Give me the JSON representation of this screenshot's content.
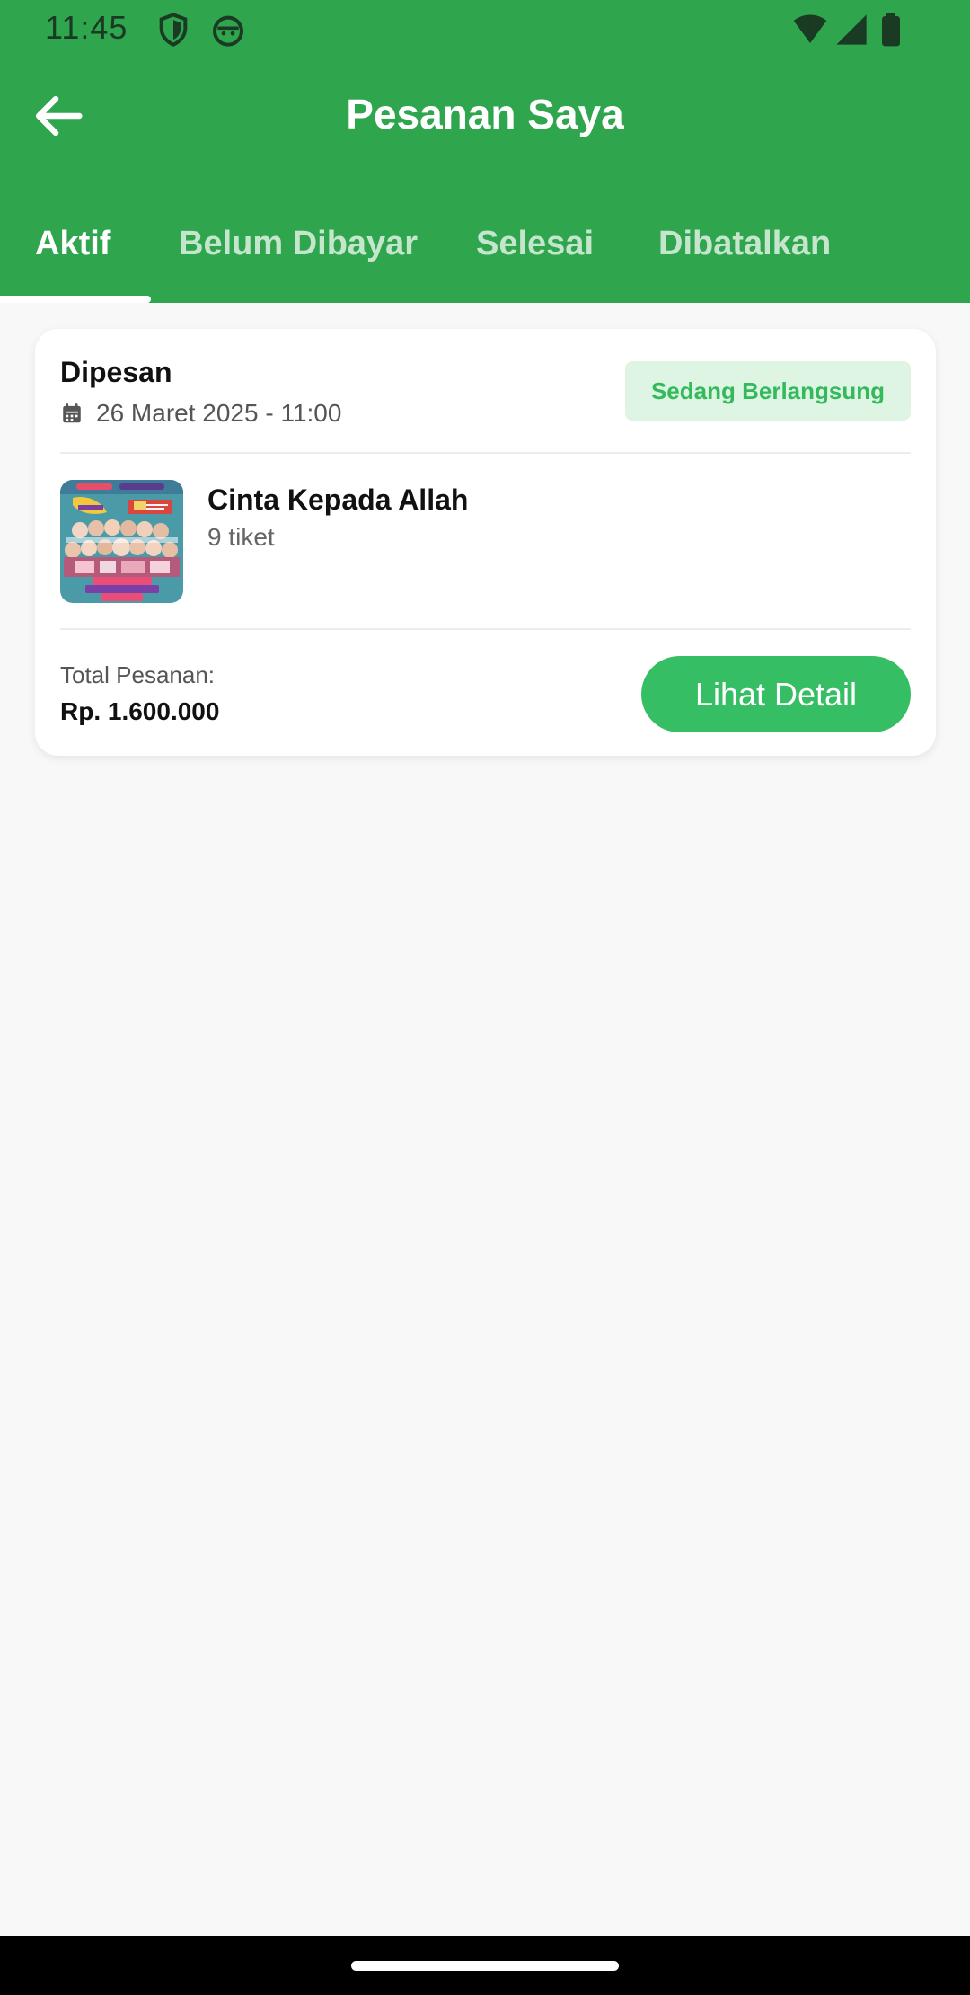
{
  "status_bar": {
    "time": "11:45",
    "icons": [
      "shield-icon",
      "android-face-icon",
      "wifi-icon",
      "cellular-signal-icon",
      "battery-icon"
    ]
  },
  "header": {
    "title": "Pesanan Saya",
    "back_icon": "arrow-left-icon",
    "background_color": "#2fa64e"
  },
  "tabs": [
    {
      "label": "Aktif",
      "active": true
    },
    {
      "label": "Belum Dibayar",
      "active": false
    },
    {
      "label": "Selesai",
      "active": false
    },
    {
      "label": "Dibatalkan",
      "active": false
    }
  ],
  "orders": [
    {
      "status_label": "Dipesan",
      "date": "26 Maret 2025 - 11:00",
      "date_icon": "calendar-icon",
      "badge": "Sedang Berlangsung",
      "event_name": "Cinta Kepada Allah",
      "tickets": "9 tiket",
      "total_label": "Total Pesanan:",
      "total_value": "Rp. 1.600.000",
      "action_label": "Lihat Detail"
    }
  ],
  "colors": {
    "accent": "#35be63",
    "badge_bg": "#dff5e3",
    "badge_text": "#34b95c"
  }
}
